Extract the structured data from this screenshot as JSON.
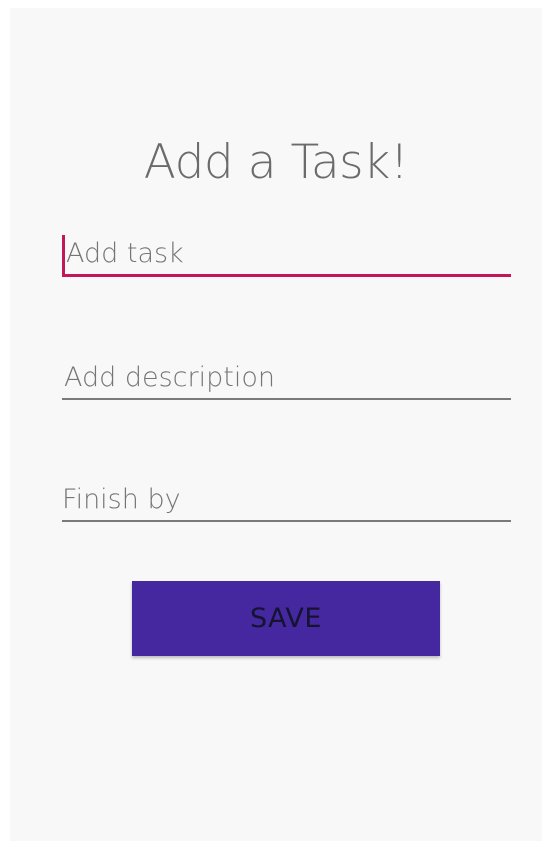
{
  "screen": {
    "title": "Add a Task!"
  },
  "form": {
    "task": {
      "placeholder": "Add task",
      "value": ""
    },
    "description": {
      "placeholder": "Add description",
      "value": ""
    },
    "finish_by": {
      "placeholder": "Finish by",
      "value": ""
    }
  },
  "actions": {
    "save_label": "SAVE"
  },
  "colors": {
    "accent": "#c2185b",
    "primary": "#4527a0",
    "background": "#f8f8f8"
  }
}
